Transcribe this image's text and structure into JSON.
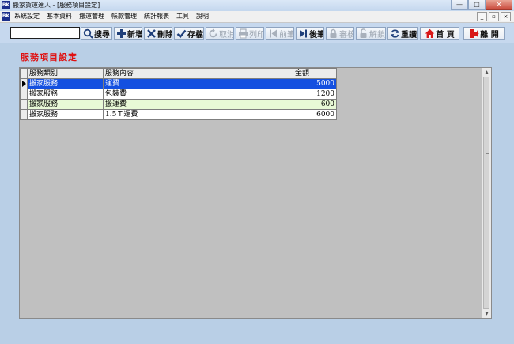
{
  "window": {
    "title": "搬家貨運達人 - [服務項目設定]",
    "app_icon": "app-logo-icon",
    "controls": [
      "—",
      "□",
      "✕"
    ]
  },
  "menu": {
    "items": [
      "系統設定",
      "基本資料",
      "搬運管理",
      "帳款管理",
      "統計報表",
      "工具",
      "說明"
    ],
    "mdi_controls": [
      "_",
      "▫",
      "×"
    ]
  },
  "toolbar": {
    "search": {
      "value": "",
      "placeholder": ""
    },
    "buttons": [
      {
        "label": "搜尋",
        "icon": "search-icon",
        "enabled": true
      },
      {
        "label": "新增",
        "icon": "plus-icon",
        "enabled": true
      },
      {
        "label": "刪除",
        "icon": "x-icon",
        "enabled": true
      },
      {
        "label": "存檔",
        "icon": "check-icon",
        "enabled": true
      },
      {
        "label": "取消",
        "icon": "undo-icon",
        "enabled": false
      },
      {
        "label": "列印",
        "icon": "printer-icon",
        "enabled": false
      },
      {
        "label": "前筆",
        "icon": "prev-record-icon",
        "enabled": false
      },
      {
        "label": "後筆",
        "icon": "next-record-icon",
        "enabled": true
      },
      {
        "label": "審核",
        "icon": "lock-icon",
        "enabled": false
      },
      {
        "label": "解鎖",
        "icon": "unlock-icon",
        "enabled": false
      },
      {
        "label": "重讀",
        "icon": "refresh-icon",
        "enabled": true
      },
      {
        "label": "首 頁",
        "icon": "home-icon",
        "enabled": true
      },
      {
        "label": "離 開",
        "icon": "exit-icon",
        "enabled": true
      }
    ]
  },
  "page": {
    "title": "服務項目設定"
  },
  "grid": {
    "columns": [
      "服務類別",
      "服務內容",
      "金額"
    ],
    "rows": [
      {
        "category": "搬家服務",
        "content": "運費",
        "amount": "5000",
        "selected": true
      },
      {
        "category": "搬家服務",
        "content": "包裝費",
        "amount": "1200",
        "selected": false
      },
      {
        "category": "搬家服務",
        "content": "搬運費",
        "amount": "600",
        "selected": false
      },
      {
        "category": "搬家服務",
        "content": "1.5Ｔ運費",
        "amount": "6000",
        "selected": false
      }
    ]
  },
  "colors": {
    "selection": "#1450e0",
    "alt_row": "#e8f9d6",
    "title_red": "#e01010",
    "background": "#b9cfe6"
  }
}
